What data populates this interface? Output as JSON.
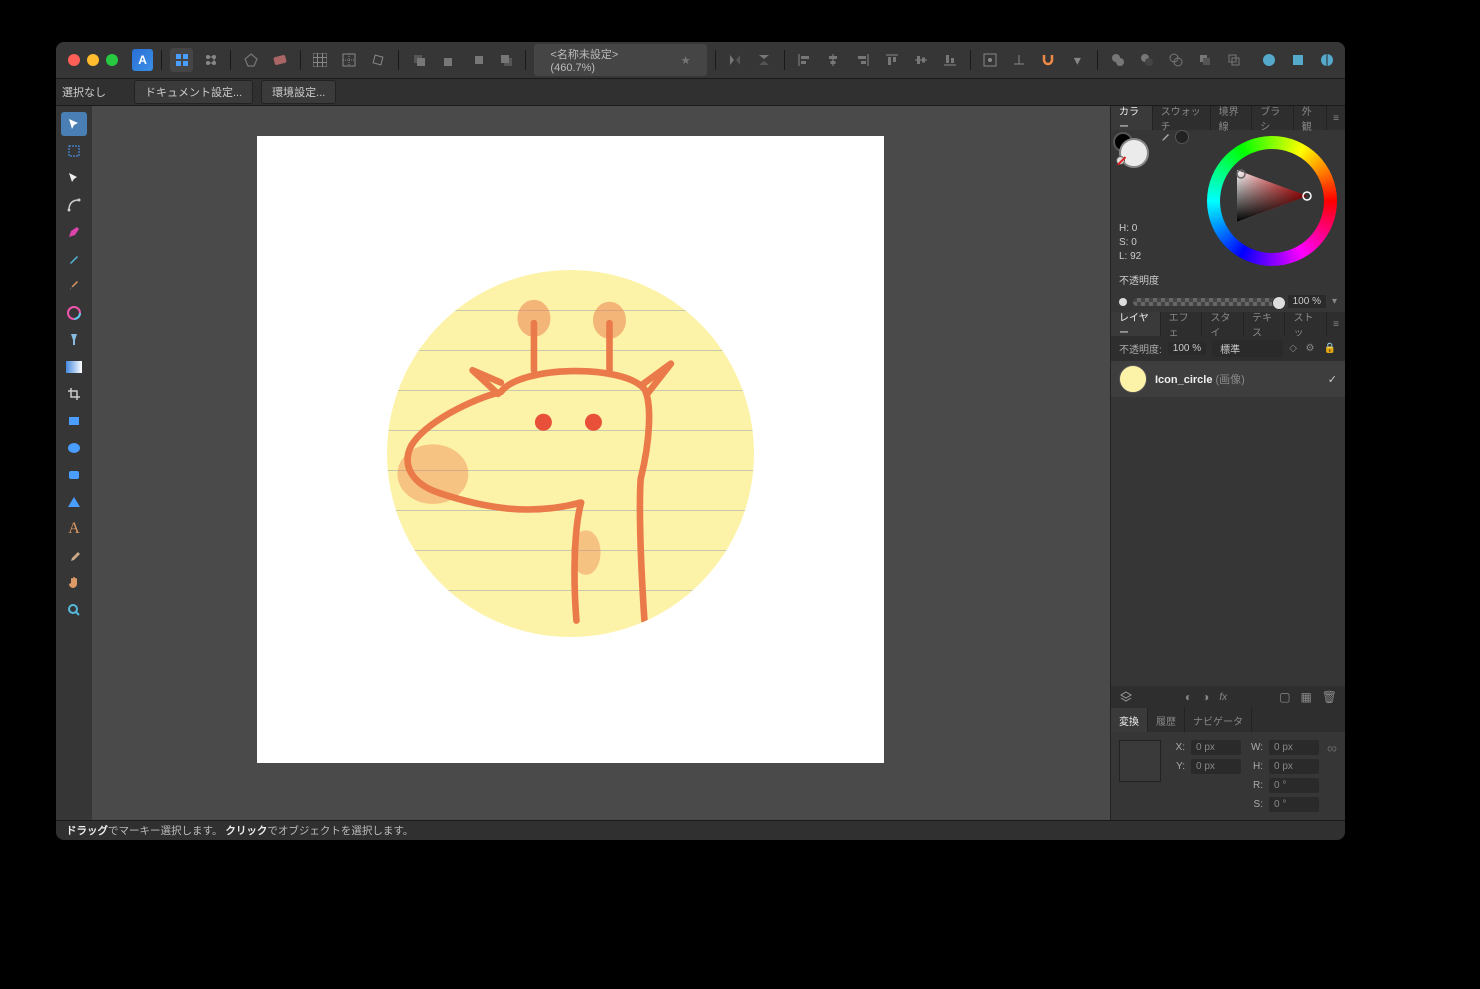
{
  "doc": {
    "title": "<名称未設定> (460.7%)",
    "star": "★"
  },
  "contextbar": {
    "selection": "選択なし",
    "doc_settings": "ドキュメント設定...",
    "prefs": "環境設定..."
  },
  "panels": {
    "color": {
      "tabs": [
        "カラー",
        "スウォッチ",
        "境界線",
        "ブラシ",
        "外観"
      ],
      "active": 0,
      "hsl": {
        "h": "H: 0",
        "s": "S: 0",
        "l": "L: 92"
      },
      "opacity_label": "不透明度",
      "opacity_value": "100 %"
    },
    "layers": {
      "tabs": [
        "レイヤー",
        "エフェ",
        "スタイ",
        "テキス",
        "ストッ"
      ],
      "active": 0,
      "opacity_label": "不透明度:",
      "opacity_value": "100 %",
      "blend": "標準",
      "item": {
        "name": "Icon_circle",
        "type": "(画像)"
      }
    },
    "transform": {
      "tabs": [
        "変換",
        "履歴",
        "ナビゲータ"
      ],
      "active": 0,
      "X": "X:",
      "Y": "Y:",
      "W": "W:",
      "H": "H:",
      "R": "R:",
      "S": "S:",
      "px": "0 px",
      "deg": "0 °"
    }
  },
  "status": {
    "t1": "ドラッグ",
    "t2": "でマーキー選択します。",
    "t3": "クリック",
    "t4": "でオブジェクトを選択します。"
  }
}
